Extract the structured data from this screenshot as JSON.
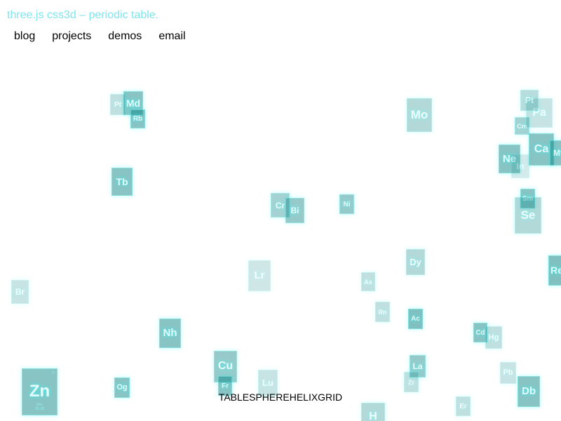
{
  "header": {
    "title": "three.js css3d – periodic table."
  },
  "nav": {
    "items": [
      "blog",
      "projects",
      "demos",
      "email"
    ]
  },
  "menu": {
    "buttons": [
      "TABLE",
      "SPHERE",
      "HELIX",
      "GRID"
    ]
  },
  "elements": [
    {
      "symbol": "Md"
    },
    {
      "symbol": "Pt"
    },
    {
      "symbol": "Rb"
    },
    {
      "symbol": "Tb"
    },
    {
      "symbol": "Mo"
    },
    {
      "symbol": "Cr"
    },
    {
      "symbol": "Bi"
    },
    {
      "symbol": "Ni"
    },
    {
      "symbol": "Cm"
    },
    {
      "symbol": "Ca"
    },
    {
      "symbol": "Ne"
    },
    {
      "symbol": "Sm"
    },
    {
      "symbol": "Se"
    },
    {
      "symbol": "Dy"
    },
    {
      "symbol": "Br"
    },
    {
      "symbol": "Lr"
    },
    {
      "symbol": "As"
    },
    {
      "symbol": "Rn"
    },
    {
      "symbol": "Ac"
    },
    {
      "symbol": "Nh"
    },
    {
      "symbol": "Cd"
    },
    {
      "symbol": "Hg"
    },
    {
      "symbol": "Cu"
    },
    {
      "symbol": "Fr"
    },
    {
      "symbol": "Lu"
    },
    {
      "symbol": "La"
    },
    {
      "symbol": "Zr"
    },
    {
      "symbol": "Pb"
    },
    {
      "symbol": "Db"
    },
    {
      "symbol": "Zn",
      "name": "Zinc",
      "mass": "65.38",
      "number": "30"
    },
    {
      "symbol": "Og"
    },
    {
      "symbol": "H"
    },
    {
      "symbol": "Er"
    },
    {
      "symbol": "Re"
    },
    {
      "symbol": "Pa"
    },
    {
      "symbol": "Pt"
    },
    {
      "symbol": "In"
    },
    {
      "symbol": "Mt"
    }
  ]
}
